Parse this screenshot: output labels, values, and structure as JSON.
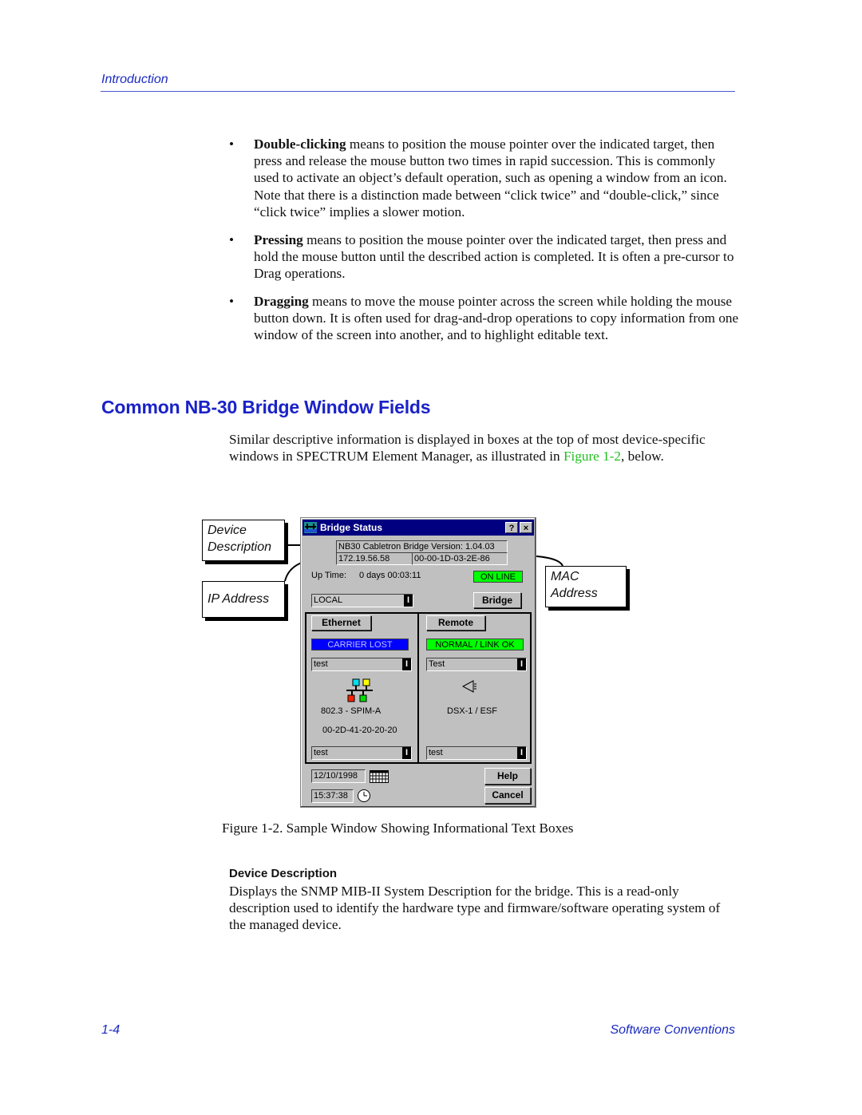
{
  "header": {
    "section": "Introduction"
  },
  "bullets": [
    {
      "term": "Double-clicking",
      "text": " means to position the mouse pointer over the indicated target, then press and release the mouse button two times in rapid succession. This is commonly used to activate an object’s default operation, such as opening a window from an icon. Note that there is a distinction made between “click twice” and “double-click,” since “click twice” implies a slower motion."
    },
    {
      "term": "Pressing",
      "text": " means to position the mouse pointer over the indicated target, then press and hold the mouse button until the described action is completed. It is often a pre-cursor to Drag operations."
    },
    {
      "term": "Dragging",
      "text": " means to move the mouse pointer across the screen while holding the mouse button down. It is often used for drag-and-drop operations to copy information from one window of the screen into another, and to highlight editable text."
    }
  ],
  "section_heading": "Common NB-30 Bridge Window Fields",
  "intro": {
    "before": "Similar descriptive information is displayed in boxes at the top of most device-specific windows in SPECTRUM Element Manager, as illustrated in ",
    "link": "Figure 1-2",
    "after": ", below."
  },
  "figure": {
    "callouts": {
      "device_description": [
        "Device",
        "Description"
      ],
      "ip_address": "IP Address",
      "mac_address": [
        "MAC",
        "Address"
      ]
    },
    "window": {
      "title": "Bridge Status",
      "help_btn": "?",
      "close_btn": "×",
      "device_description": "NB30 Cabletron Bridge Version: 1.04.03",
      "ip_address": "172.19.56.58",
      "mac_address": "00-00-1D-03-2E-86",
      "uptime_label": "Up Time:",
      "uptime_value": "0 days 00:03:11",
      "online_status": "ON  LINE",
      "location": "LOCAL",
      "bridge_btn": "Bridge",
      "ethernet": {
        "button": "Ethernet",
        "status": "CARRIER LOST",
        "name_field": "test",
        "type": "802.3 - SPIM-A",
        "mac": "00-2D-41-20-20-20",
        "bottom_field": "test"
      },
      "remote": {
        "button": "Remote",
        "status": "NORMAL / LINK OK",
        "name_field": "Test",
        "type": "DSX-1 / ESF",
        "bottom_field": "test"
      },
      "date": "12/10/1998",
      "time": "15:37:38",
      "help_button": "Help",
      "cancel_button": "Cancel"
    },
    "colors": {
      "online": "#00ff00",
      "carrier_lost": "#0000ff",
      "normal_link_ok": "#00ff00",
      "titlebar": "#000080"
    },
    "caption": "Figure 1-2.  Sample Window Showing Informational Text Boxes"
  },
  "device_description_section": {
    "heading": "Device Description",
    "text": "Displays the SNMP MIB-II System Description for the bridge. This is a read-only description used to identify the hardware type and firmware/software operating system of the managed device."
  },
  "footer": {
    "page": "1-4",
    "title": "Software Conventions"
  }
}
